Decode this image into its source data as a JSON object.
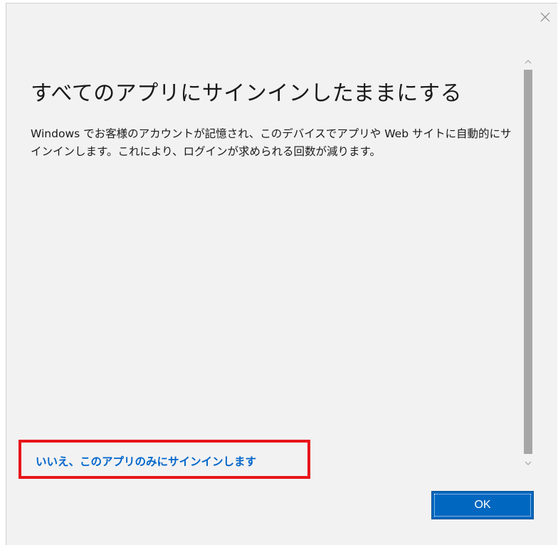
{
  "dialog": {
    "title": "すべてのアプリにサインインしたままにする",
    "description": "Windows でお客様のアカウントが記憶され、このデバイスでアプリや Web サイトに自動的にサインインします。これにより、ログインが求められる回数が減ります。",
    "link_label": "いいえ、このアプリのみにサインインします",
    "ok_label": "OK"
  },
  "icons": {
    "close": "close-icon",
    "scroll_up": "chevron-up-icon",
    "scroll_down": "chevron-down-icon"
  },
  "colors": {
    "background": "#f2f2f2",
    "accent": "#0067c0",
    "link": "#0066cc",
    "highlight": "#e8151a",
    "scroll_thumb": "#a6a6a6"
  }
}
